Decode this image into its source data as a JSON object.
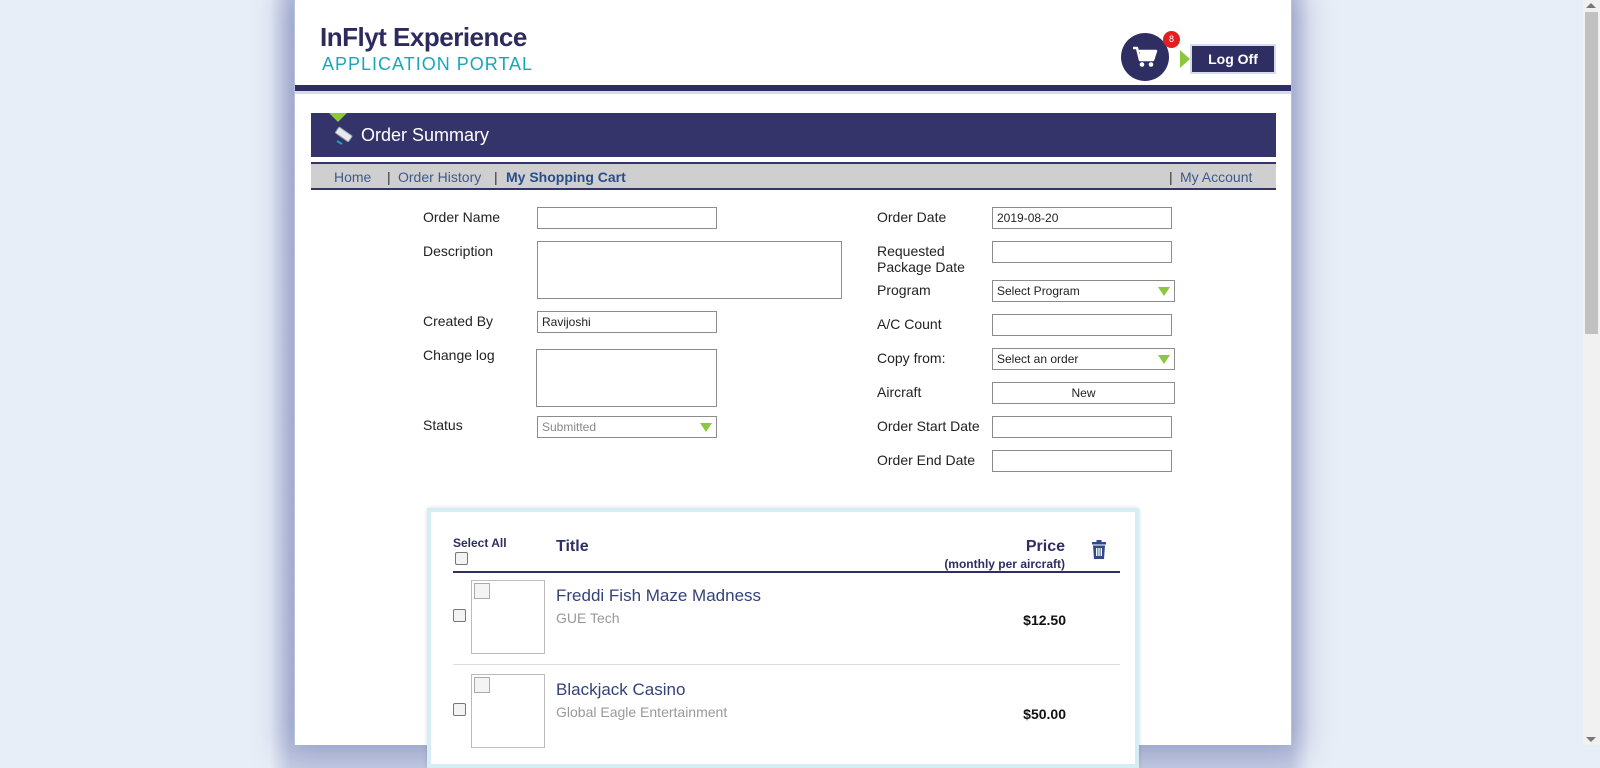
{
  "header": {
    "logo_title": "InFlyt Experience",
    "logo_subtitle": "APPLICATION PORTAL",
    "cart_count": "8",
    "logoff_label": "Log Off"
  },
  "page_title": "Order Summary",
  "nav": {
    "home": "Home",
    "sep": "|",
    "order_history": "Order History",
    "cart": "My Shopping Cart",
    "account": "My Account"
  },
  "form_left": {
    "order_name_label": "Order Name",
    "order_name_value": "",
    "description_label": "Description",
    "description_value": "",
    "created_by_label": "Created By",
    "created_by_value": "Ravijoshi",
    "change_log_label": "Change log",
    "change_log_value": "",
    "status_label": "Status",
    "status_value": "Submitted"
  },
  "form_right": {
    "order_date_label": "Order Date",
    "order_date_value": "2019-08-20",
    "requested_label_1": "Requested",
    "requested_label_2": "Package Date",
    "requested_value": "",
    "program_label": "Program",
    "program_value": "Select Program",
    "ac_count_label": "A/C Count",
    "ac_count_value": "",
    "copy_from_label": "Copy from:",
    "copy_from_value": "Select an order",
    "aircraft_label": "Aircraft",
    "aircraft_button": "New",
    "start_label": "Order Start Date",
    "start_value": "",
    "end_label": "Order End Date",
    "end_value": ""
  },
  "cart": {
    "select_all": "Select All",
    "title_header": "Title",
    "price_header": "Price",
    "price_sub": "(monthly per aircraft)",
    "items": [
      {
        "title": "Freddi Fish Maze Madness",
        "vendor": "GUE Tech",
        "price": "$12.50"
      },
      {
        "title": "Blackjack Casino",
        "vendor": "Global Eagle Entertainment",
        "price": "$50.00"
      }
    ]
  },
  "icons": {
    "cart": "shopping-cart-icon",
    "title_bar": "tablet-pen-icon",
    "delete": "trash-icon"
  },
  "colors": {
    "primary": "#2f2e63",
    "accent": "#8dc63f",
    "teal": "#1aa6b8",
    "badge": "#e02020"
  }
}
